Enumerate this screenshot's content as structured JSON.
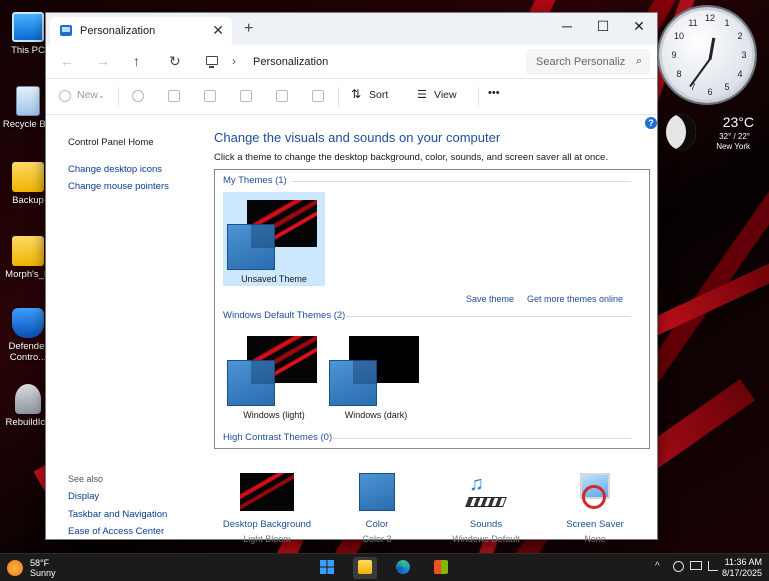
{
  "desktop": {
    "icons": [
      {
        "label": "This PC"
      },
      {
        "label": "Recycle Bin"
      },
      {
        "label": "Backup"
      },
      {
        "label": "Morph's_D"
      },
      {
        "label": "Defender Contro..."
      },
      {
        "label": "RebuildIco"
      }
    ]
  },
  "window": {
    "tab_title": "Personalization",
    "new_tab_glyph": "+",
    "minimize_glyph": "─",
    "maximize_glyph": "☐",
    "close_glyph": "✕",
    "tab_close_glyph": "✕"
  },
  "navbar": {
    "back_glyph": "←",
    "forward_glyph": "→",
    "up_glyph": "↑",
    "refresh_glyph": "↻",
    "chevron_glyph": "›",
    "breadcrumb": "Personalization",
    "search_placeholder": "Search Personaliz",
    "search_glyph": "⌕"
  },
  "toolbar": {
    "new_label": "New",
    "sort_label": "Sort",
    "view_label": "View",
    "more_glyph": "•••"
  },
  "left_pane": {
    "control_panel_home": "Control Panel Home",
    "change_desktop_icons": "Change desktop icons",
    "change_mouse_pointers": "Change mouse pointers",
    "see_also": "See also",
    "display": "Display",
    "taskbar_navigation": "Taskbar and Navigation",
    "ease_of_access": "Ease of Access Center"
  },
  "main": {
    "heading": "Change the visuals and sounds on your computer",
    "subheading": "Click a theme to change the desktop background, color, sounds, and screen saver all at once.",
    "help_glyph": "?",
    "my_themes_label": "My Themes (1)",
    "unsaved_theme": "Unsaved Theme",
    "save_theme": "Save theme",
    "get_more_themes": "Get more themes online",
    "default_themes_label": "Windows Default Themes (2)",
    "windows_light": "Windows (light)",
    "windows_dark": "Windows (dark)",
    "high_contrast_label": "High Contrast Themes (0)"
  },
  "bottom": {
    "desktop_background": {
      "label": "Desktop Background",
      "value": "Light Bloom"
    },
    "color": {
      "label": "Color",
      "value": "Color 3"
    },
    "sounds": {
      "label": "Sounds",
      "value": "Windows Default"
    },
    "screen_saver": {
      "label": "Screen Saver",
      "value": "None"
    }
  },
  "clock_widget": {
    "numbers": [
      "12",
      "1",
      "2",
      "3",
      "4",
      "5",
      "6",
      "7",
      "8",
      "9",
      "10",
      "11"
    ]
  },
  "weather_widget": {
    "temperature": "23°C",
    "range": "32° / 22°",
    "city": "New York"
  },
  "taskbar": {
    "temperature": "58°F",
    "condition": "Sunny",
    "tray_glyphs": "^",
    "time": "11:36 AM",
    "date": "8/17/2025"
  },
  "colors": {
    "accent_link": "#1e4e9a",
    "selection": "#cce8ff",
    "taskbar": "#1b1b1b"
  }
}
